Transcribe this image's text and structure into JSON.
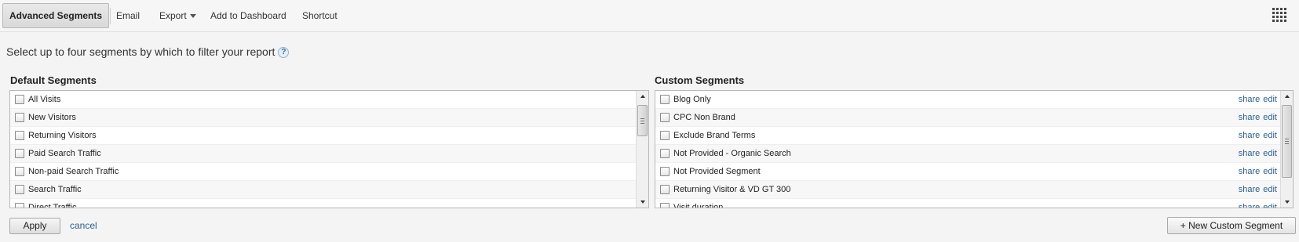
{
  "toolbar": {
    "advanced_segments": "Advanced Segments",
    "email": "Email",
    "export": "Export",
    "add_to_dashboard": "Add to Dashboard",
    "shortcut": "Shortcut",
    "grid_icon": "grid-icon"
  },
  "instructions": "Select up to four segments by which to filter your report",
  "help_icon": "?",
  "default_segments": {
    "title": "Default Segments",
    "items": [
      {
        "label": "All Visits"
      },
      {
        "label": "New Visitors"
      },
      {
        "label": "Returning Visitors"
      },
      {
        "label": "Paid Search Traffic"
      },
      {
        "label": "Non-paid Search Traffic"
      },
      {
        "label": "Search Traffic"
      },
      {
        "label": "Direct Traffic"
      }
    ]
  },
  "custom_segments": {
    "title": "Custom Segments",
    "share_label": "share",
    "edit_label": "edit",
    "items": [
      {
        "label": "Blog Only"
      },
      {
        "label": "CPC Non Brand"
      },
      {
        "label": "Exclude Brand Terms"
      },
      {
        "label": "Not Provided - Organic Search"
      },
      {
        "label": "Not Provided Segment"
      },
      {
        "label": "Returning Visitor & VD GT 300"
      },
      {
        "label": "Visit duration"
      }
    ]
  },
  "footer": {
    "apply": "Apply",
    "cancel": "cancel",
    "new_custom_segment": "+ New Custom Segment"
  },
  "colors": {
    "link": "#2b5f8e",
    "background": "#f4f4f4"
  }
}
